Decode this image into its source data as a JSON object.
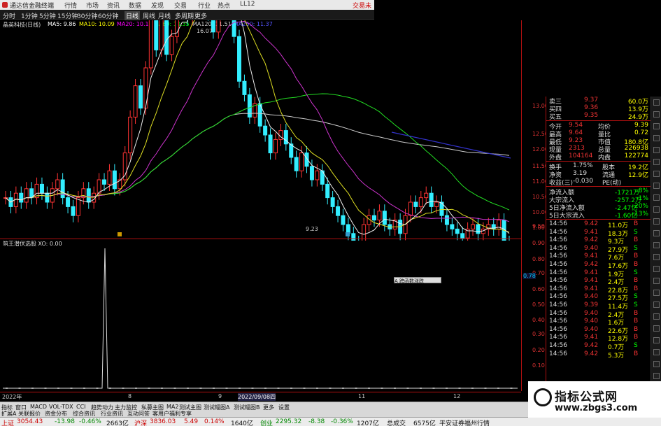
{
  "titlebar": {
    "title": "通达信金融终端",
    "tabs": [
      "行情",
      "市场",
      "资讯",
      "数据",
      "发现",
      "交易",
      "行业",
      "热点",
      "LL12"
    ],
    "right": "交易未"
  },
  "periods": [
    "分时",
    "1分钟",
    "5分钟",
    "15分钟",
    "30分钟",
    "60分钟",
    "日线",
    "周线",
    "月线",
    "多周期",
    "更多"
  ],
  "active_period": "日线",
  "ma_legend": {
    "stock": "晶英科技(日线)",
    "ma5": "MA5: 9.86",
    "ma10": "MA10: 10.09",
    "ma20": "MA20: 10.16",
    "ma60": "MA60: 10.35",
    "ma120": "MA120: 11.51",
    "ma250": "MA250: 11.37",
    "colors": {
      "ma5": "#ffffff",
      "ma10": "#ffff00",
      "ma20": "#ff00ff",
      "ma60": "#00ff00",
      "ma120": "#cccccc",
      "ma250": "#3333cc"
    }
  },
  "annotations": {
    "high": "16.07",
    "low": "9.23"
  },
  "ind_title": "筑王潜伏选股 XO: 0.00",
  "tooltip": "A 跨函数涨跌",
  "price_ticks": [
    "13.00",
    "12.50",
    "12.00",
    "11.50",
    "11.00",
    "10.50",
    "10.00",
    "9.50"
  ],
  "ind_ticks": [
    "1.00",
    "0.90",
    "0.80",
    "0.70",
    "0.60",
    "0.50",
    "0.40",
    "0.30",
    "0.20",
    "0.10"
  ],
  "ind_marker": "0.78",
  "dates": [
    "2022年",
    "8",
    "9",
    "2022/09/08四",
    "11",
    "12"
  ],
  "quote": {
    "asks": [
      {
        "label": "卖三",
        "price": "9.37",
        "vol": "60.0万"
      },
      {
        "label": "买四",
        "price": "9.36",
        "vol": "13.9万"
      },
      {
        "label": "买五",
        "price": "9.35",
        "vol": "24.9万"
      }
    ],
    "stats": [
      {
        "l": "今开",
        "m": "9.54",
        "ml": "均价",
        "v": "9.39"
      },
      {
        "l": "最高",
        "m": "9.64",
        "ml": "量比",
        "v": "0.72"
      },
      {
        "l": "最低",
        "m": "9.23",
        "ml": "市值",
        "v": "180.8亿"
      },
      {
        "l": "现量",
        "m": "2313",
        "ml": "总量",
        "v": "226938"
      },
      {
        "l": "外盘",
        "m": "104164",
        "ml": "内盘",
        "v": "122774"
      }
    ],
    "stats2": [
      {
        "l": "换手",
        "m": "1.75%",
        "ml": "股本",
        "v": "19.2亿"
      },
      {
        "l": "净资",
        "m": "3.19",
        "ml": "流通",
        "v": "12.9亿"
      },
      {
        "l": "收益(三)",
        "m": "-0.030",
        "ml": "PE(动)",
        "v": ""
      }
    ],
    "flows": [
      {
        "l": "净流入额",
        "v": "-1721万",
        "p": "-8%"
      },
      {
        "l": "大宗流入",
        "v": "-257.2万",
        "p": "-1%"
      },
      {
        "l": "5日净流入额",
        "v": "-2.47亿",
        "p": "-20%"
      },
      {
        "l": "5日大宗流入",
        "v": "-1.60亿",
        "p": "-13%"
      }
    ],
    "ticks": [
      {
        "t": "14:56",
        "p": "9.42",
        "q": "11.0万",
        "d": "B"
      },
      {
        "t": "14:56",
        "p": "9.41",
        "q": "18.3万",
        "d": "S"
      },
      {
        "t": "14:56",
        "p": "9.42",
        "q": "9.3万",
        "d": "B"
      },
      {
        "t": "14:56",
        "p": "9.40",
        "q": "27.9万",
        "d": "S"
      },
      {
        "t": "14:56",
        "p": "9.41",
        "q": "7.6万",
        "d": "B"
      },
      {
        "t": "14:56",
        "p": "9.42",
        "q": "17.6万",
        "d": "B"
      },
      {
        "t": "14:56",
        "p": "9.41",
        "q": "1.9万",
        "d": "S"
      },
      {
        "t": "14:56",
        "p": "9.41",
        "q": "2.4万",
        "d": "B"
      },
      {
        "t": "14:56",
        "p": "9.41",
        "q": "22.8万",
        "d": "B"
      },
      {
        "t": "14:56",
        "p": "9.40",
        "q": "27.5万",
        "d": "S"
      },
      {
        "t": "14:56",
        "p": "9.39",
        "q": "11.4万",
        "d": "S"
      },
      {
        "t": "14:56",
        "p": "9.40",
        "q": "2.4万",
        "d": "B"
      },
      {
        "t": "14:56",
        "p": "9.40",
        "q": "1.6万",
        "d": "B"
      },
      {
        "t": "14:56",
        "p": "9.40",
        "q": "22.6万",
        "d": "B"
      },
      {
        "t": "14:56",
        "p": "9.41",
        "q": "12.8万",
        "d": "B"
      },
      {
        "t": "14:56",
        "p": "9.42",
        "q": "0.7万",
        "d": "S"
      },
      {
        "t": "14:56",
        "p": "9.42",
        "q": "5.3万",
        "d": "B"
      }
    ]
  },
  "bottom_tabs": [
    "指标",
    "窗口",
    "MACD",
    "VOL-TDX",
    "CCI",
    "趋势动力",
    "主力监控",
    "私募主图",
    "MA2",
    "测试主图",
    "测试幅图A",
    "测试幅图B",
    "更多",
    "设置"
  ],
  "bottom_tabs2": [
    "扩展A",
    "关联报价",
    "资金分布",
    "综合资讯",
    "行业资讯",
    "互动问答",
    "客用户福利专享"
  ],
  "status": {
    "sh_label": "上证",
    "sh_val": "3054.43",
    "sh_chg": "-13.98",
    "sh_pct": "-0.46%",
    "sh_amt": "2663亿",
    "sz_label": "沪深",
    "sz_val": "3836.03",
    "sz_chg": "5.49",
    "sz_pct": "0.14%",
    "sz_amt": "1640亿",
    "cy_label": "创业",
    "cy_val": "2295.32",
    "cy_chg": "-8.38",
    "cy_pct": "-0.36%",
    "cy_amt": "1207亿",
    "total_label": "总成交",
    "total": "6575亿",
    "broker": "平安证券福州行情"
  },
  "watermark": {
    "line1": "指标公式网",
    "line2": "www.zbgs3.com"
  }
}
